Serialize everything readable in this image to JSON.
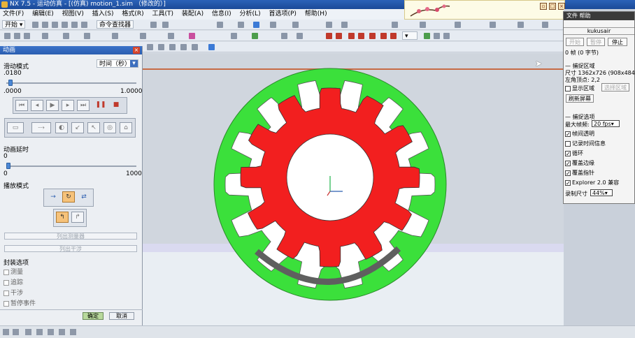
{
  "window": {
    "title": "NX 7.5 - 运动仿真 - [(仿真) motion_1.sim （修改的）]"
  },
  "menu": [
    "文件(F)",
    "编辑(E)",
    "视图(V)",
    "插入(S)",
    "格式(R)",
    "工具(T)",
    "装配(A)",
    "信息(I)",
    "分析(L)",
    "首选项(P)",
    "帮助(H)"
  ],
  "toolbar": {
    "start_label": "开始",
    "command_finder_label": "命令查找器"
  },
  "panel": {
    "title": "动画",
    "slider_mode_label": "滑动模式",
    "time_dropdown": "时间（秒）",
    "slider_current": ".0180",
    "slider_min": ".0000",
    "slider_max": "1.0000",
    "slider_fraction": 0.018,
    "delay_label": "动画延时",
    "delay_value": "0",
    "delay_min": "0",
    "delay_max": "1000",
    "play_mode_label": "播放模式",
    "list_events_label": "列出测量器",
    "list_interference_label": "列出干涉",
    "package_options_label": "封装选项",
    "options": [
      "测量",
      "追踪",
      "干涉",
      "暂停事件"
    ],
    "ok_label": "确定",
    "cancel_label": "取消"
  },
  "recorder": {
    "title": "文件  帮助",
    "window_name": "kukusair",
    "btn_start": "开始",
    "btn_pause": "暂停",
    "btn_stop": "停止",
    "info": "0 帧 (0 字节)",
    "capture_area_label": "捕捉区域",
    "size_line": "尺寸  1362x726 (908x484)",
    "topleft_line": "左角顶点:    2,2",
    "show_area_label": "显示区域",
    "select_area_label": "选择区域",
    "refresh_label": "刷新屏幕",
    "capture_options_label": "捕捉选项",
    "max_fps_label": "最大帧频:",
    "max_fps_value": "20 fps",
    "opt_transparent": "帧间透明",
    "opt_timeinfo": "记录时间信息",
    "opt_loop": "循环",
    "opt_border": "覆盖边缘",
    "opt_cursor": "覆盖指针",
    "opt_explorer": "Explorer 2.0 兼容",
    "record_size_label": "录制尺寸",
    "record_size_value": "44%"
  },
  "colors": {
    "ring": "#3be03b",
    "gear": "#f21f1f",
    "arc": "#5f5f5f",
    "title_blue": "#2b62b8"
  },
  "icons": [
    "app-icon",
    "plum-blossom-icon",
    "play-icon",
    "pause-icon",
    "stop-icon",
    "cursor-icon"
  ]
}
